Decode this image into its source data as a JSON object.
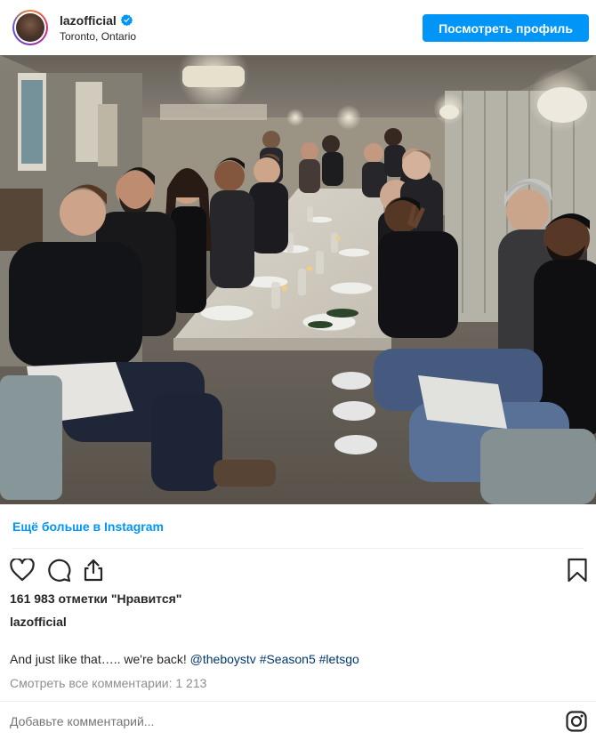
{
  "header": {
    "username": "lazofficial",
    "location": "Toronto, Ontario",
    "view_profile_label": "Посмотреть профиль"
  },
  "post": {
    "more_link": "Ещё больше в Instagram",
    "likes": "161 983 отметки \"Нравится\"",
    "caption_user": "lazofficial",
    "caption_text": "And just like that….. we're back!",
    "caption_tags": [
      "@theboystv",
      "#Season5",
      "#letsgo"
    ],
    "view_comments": "Смотреть все комментарии: 1 213",
    "comment_placeholder": "Добавьте комментарий..."
  },
  "icons": {
    "verified": "verified-badge-icon",
    "like": "heart-icon",
    "comment": "comment-bubble-icon",
    "share": "share-icon",
    "save": "bookmark-icon",
    "brand": "instagram-logo-icon"
  },
  "colors": {
    "accent": "#0095f6",
    "hashtag": "#00376b",
    "muted": "#8e8e8e",
    "text": "#262626"
  }
}
